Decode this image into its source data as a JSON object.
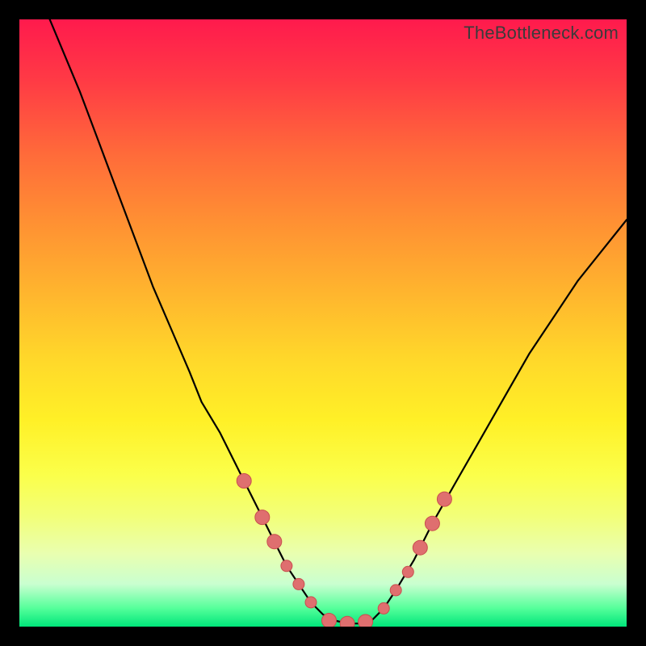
{
  "watermark": "TheBottleneck.com",
  "colors": {
    "curve": "#000000",
    "marker_fill": "#df6f6f",
    "marker_stroke": "#c94f4f"
  },
  "chart_data": {
    "type": "line",
    "title": "",
    "xlabel": "",
    "ylabel": "",
    "xlim": [
      0,
      100
    ],
    "ylim": [
      0,
      100
    ],
    "grid": false,
    "legend": false,
    "series": [
      {
        "name": "bottleneck-curve",
        "x": [
          0,
          5,
          10,
          13,
          16,
          19,
          22,
          25,
          28,
          30,
          33,
          36,
          38,
          40,
          42,
          44,
          46,
          48,
          50,
          52,
          54,
          56,
          58,
          60,
          62,
          65,
          68,
          72,
          76,
          80,
          84,
          88,
          92,
          96,
          100
        ],
        "y": [
          110,
          100,
          88,
          80,
          72,
          64,
          56,
          49,
          42,
          37,
          32,
          26,
          22,
          18,
          14,
          10,
          7,
          4,
          2,
          1,
          0.5,
          0.5,
          1,
          3,
          6,
          11,
          17,
          24,
          31,
          38,
          45,
          51,
          57,
          62,
          67
        ]
      }
    ],
    "markers": [
      {
        "name": "left-band-1",
        "x": 37,
        "y": 24
      },
      {
        "name": "left-band-2",
        "x": 40,
        "y": 18
      },
      {
        "name": "left-band-3",
        "x": 42,
        "y": 14
      },
      {
        "name": "left-dot-1",
        "x": 44,
        "y": 10
      },
      {
        "name": "left-dot-2",
        "x": 46,
        "y": 7
      },
      {
        "name": "left-dot-3",
        "x": 48,
        "y": 4
      },
      {
        "name": "bottom-band-1",
        "x": 51,
        "y": 1
      },
      {
        "name": "bottom-band-2",
        "x": 54,
        "y": 0.5
      },
      {
        "name": "bottom-band-3",
        "x": 57,
        "y": 0.8
      },
      {
        "name": "right-dot-1",
        "x": 60,
        "y": 3
      },
      {
        "name": "right-dot-2",
        "x": 62,
        "y": 6
      },
      {
        "name": "right-dot-3",
        "x": 64,
        "y": 9
      },
      {
        "name": "right-band-1",
        "x": 66,
        "y": 13
      },
      {
        "name": "right-band-2",
        "x": 68,
        "y": 17
      },
      {
        "name": "right-band-3",
        "x": 70,
        "y": 21
      }
    ]
  }
}
